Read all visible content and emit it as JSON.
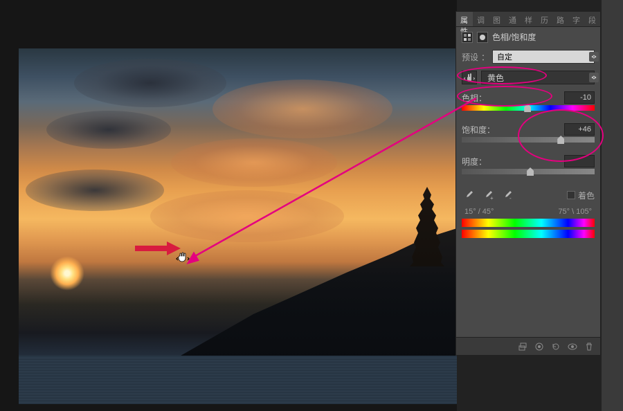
{
  "tabs": {
    "properties": "属性",
    "t1": "调",
    "t2": "图",
    "t3": "通",
    "t4": "样",
    "t5": "历",
    "t6": "路",
    "t7": "字",
    "t8": "段"
  },
  "adjustment": {
    "title": "色相/饱和度"
  },
  "preset": {
    "label": "预设",
    "value": "自定"
  },
  "channel": {
    "value": "黄色"
  },
  "sliders": {
    "hue": {
      "label": "色相：",
      "value": "-10"
    },
    "saturation": {
      "label": "饱和度：",
      "value": "+46"
    },
    "lightness": {
      "label": "明度：",
      "value": ""
    }
  },
  "colorize": {
    "label": "着色"
  },
  "range": {
    "left": "15° / 45°",
    "right": "75° \\ 105°"
  }
}
